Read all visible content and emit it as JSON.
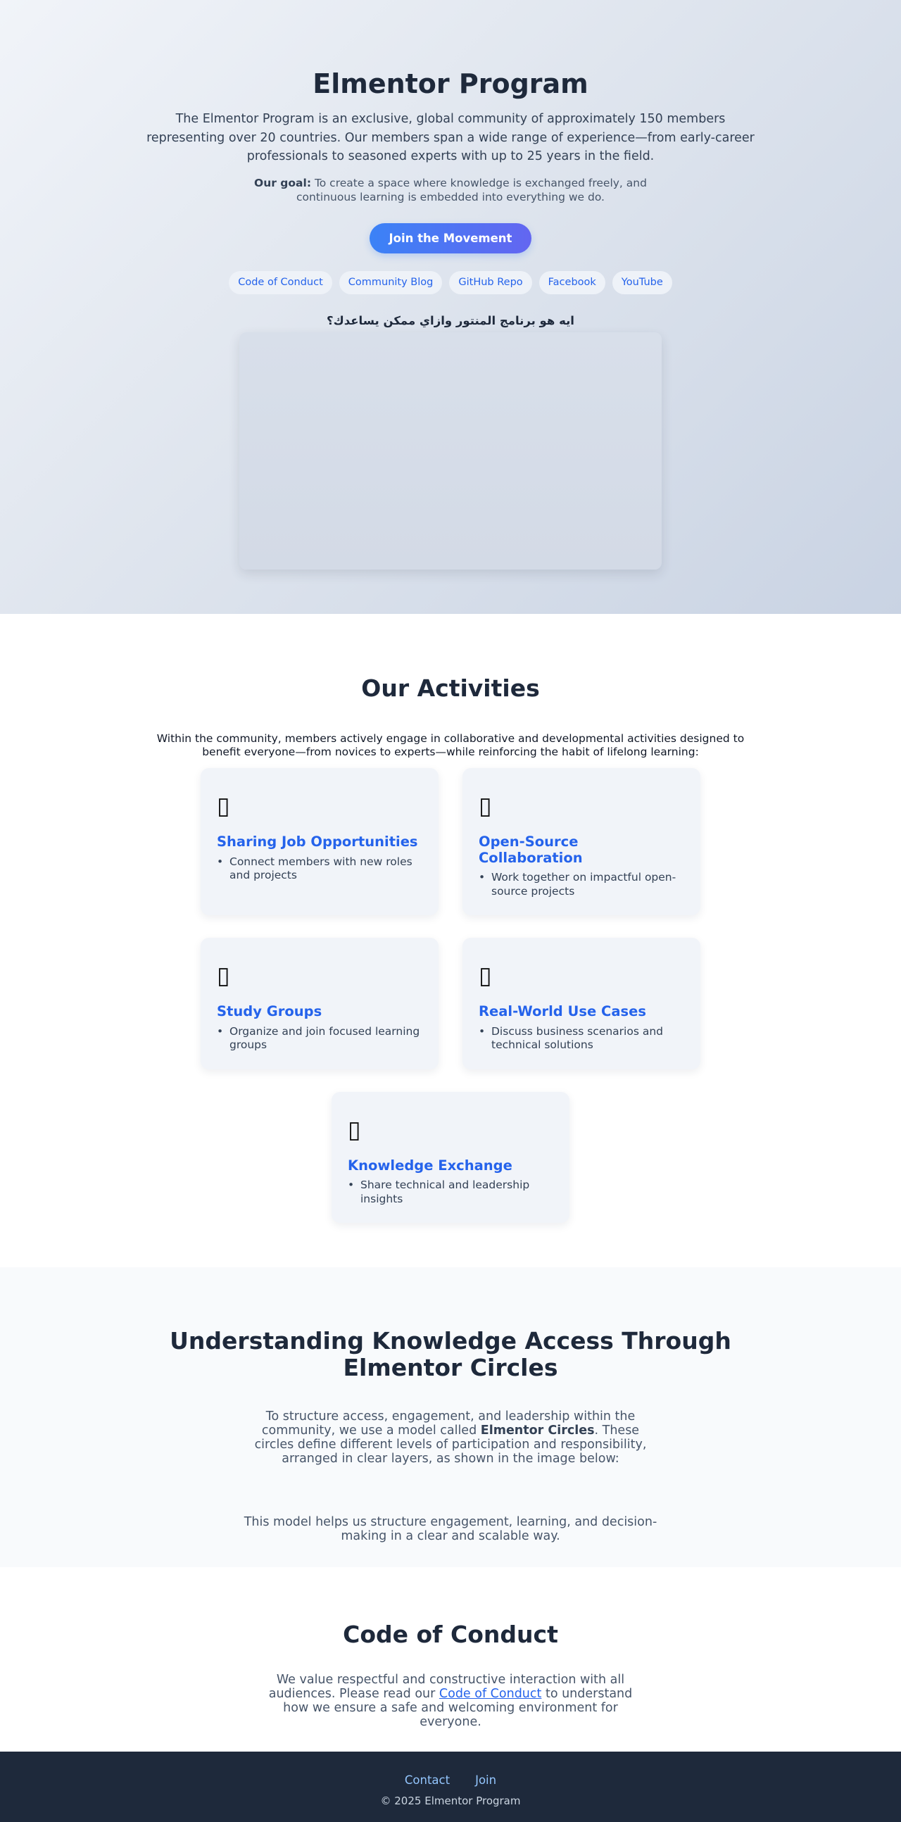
{
  "hero": {
    "title": "Elmentor Program",
    "intro": "The Elmentor Program is an exclusive, global community of approximately 150 members representing over 20 countries. Our members span a wide range of experience—from early-career professionals to seasoned experts with up to 25 years in the field.",
    "goal_label": "Our goal:",
    "goal_text": " To create a space where knowledge is exchanged freely, and continuous learning is embedded into everything we do.",
    "cta_label": "Join the Movement",
    "links": [
      "Code of Conduct",
      "Community Blog",
      "GitHub Repo",
      "Facebook",
      "YouTube"
    ],
    "video_title": "ايه هو برنامج المنتور وازاي ممكن يساعدك؟"
  },
  "activities": {
    "title": "Our Activities",
    "description": "Within the community, members actively engage in collaborative and developmental activities designed to benefit everyone—from novices to experts—while reinforcing the habit of lifelong learning:",
    "cards": [
      {
        "icon": "briefcase-icon",
        "glyph": "▯",
        "title": "Sharing Job Opportunities",
        "bullet": "Connect members with new roles and projects"
      },
      {
        "icon": "code-icon",
        "glyph": "▯",
        "title": "Open-Source Collaboration",
        "bullet": "Work together on impactful open-source projects"
      },
      {
        "icon": "books-icon",
        "glyph": "▯",
        "title": "Study Groups",
        "bullet": "Organize and join focused learning groups"
      },
      {
        "icon": "chart-icon",
        "glyph": "▯",
        "title": "Real-World Use Cases",
        "bullet": "Discuss business scenarios and technical solutions"
      },
      {
        "icon": "lightbulb-icon",
        "glyph": "▯",
        "title": "Knowledge Exchange",
        "bullet": "Share technical and leadership insights"
      }
    ]
  },
  "circles": {
    "title": "Understanding Knowledge Access Through Elmentor Circles",
    "p1_before": "To structure access, engagement, and leadership within the community, we use a model called ",
    "p1_bold": "Elmentor Circles",
    "p1_after": ". These circles define different levels of participation and responsibility, arranged in clear layers, as shown in the image below:",
    "p2": "This model helps us structure engagement, learning, and decision-making in a clear and scalable way."
  },
  "conduct": {
    "title": "Code of Conduct",
    "text_before": "We value respectful and constructive interaction with all audiences. Please read our ",
    "link_label": "Code of Conduct",
    "text_after": " to understand how we ensure a safe and welcoming environment for everyone."
  },
  "footer": {
    "links": [
      "Contact",
      "Join"
    ],
    "copyright": "© 2025 Elmentor Program"
  }
}
